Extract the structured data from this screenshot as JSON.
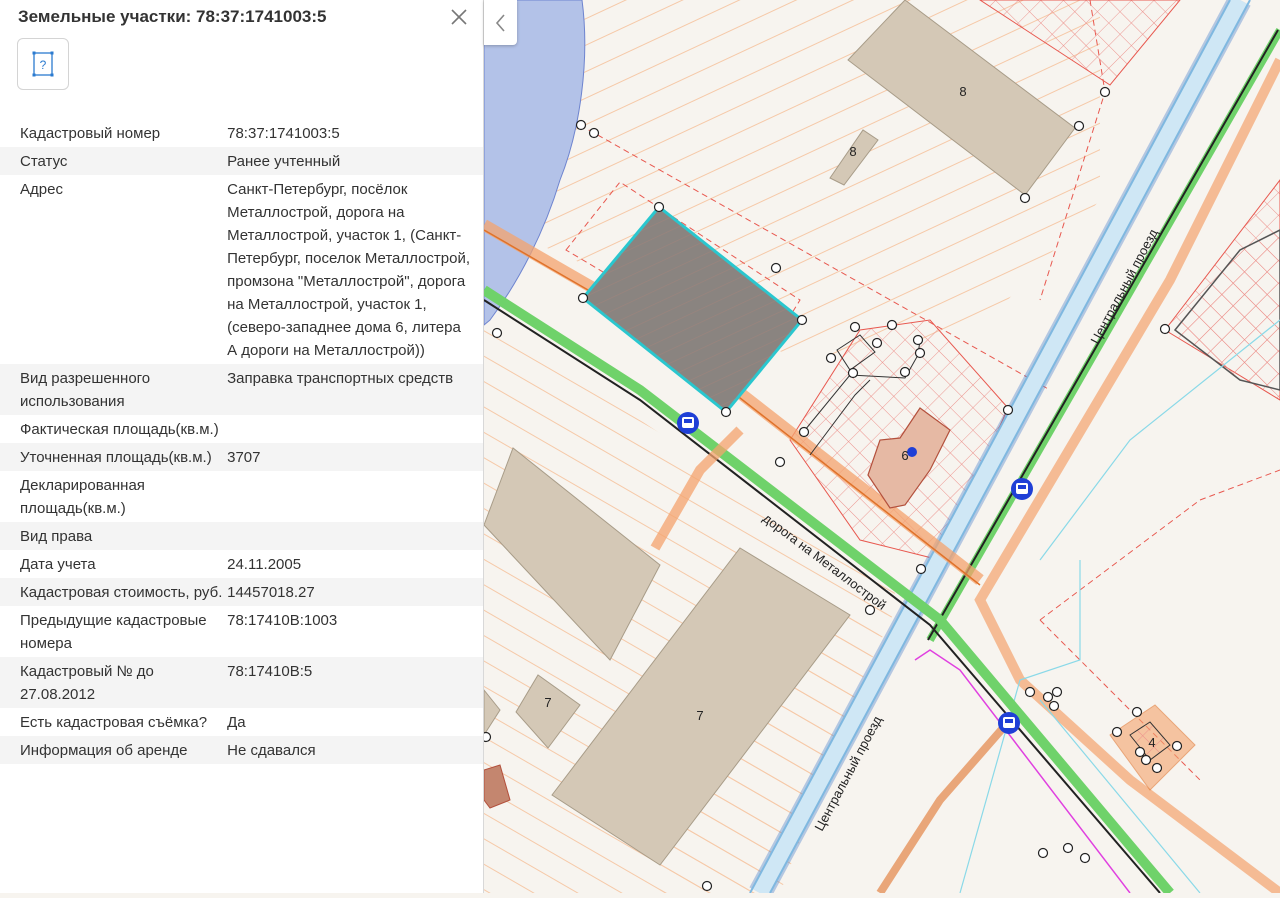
{
  "panel": {
    "title": "Земельные участки: 78:37:1741003:5",
    "close_icon": "close-icon",
    "help_icon": "parcel-help-icon",
    "rows": [
      {
        "key": "Кадастровый номер",
        "value": "78:37:1741003:5"
      },
      {
        "key": "Статус",
        "value": "Ранее учтенный"
      },
      {
        "key": "Адрес",
        "value": "Санкт-Петербург, посёлок Металлострой, дорога на Металлострой, участок 1, (Санкт-Петербург, поселок Металлострой, промзона \"Металлострой\", дорога на Металлострой, участок 1, (северо-западнее дома 6, литера А дороги на Металлострой))"
      },
      {
        "key": "Вид разрешенного использования",
        "value": "Заправка транспортных средств"
      },
      {
        "key": "Фактическая площадь(кв.м.)",
        "value": ""
      },
      {
        "key": "Уточненная площадь(кв.м.)",
        "value": "3707"
      },
      {
        "key": "Декларированная площадь(кв.м.)",
        "value": ""
      },
      {
        "key": "Вид права",
        "value": ""
      },
      {
        "key": "Дата учета",
        "value": "24.11.2005"
      },
      {
        "key": "Кадастровая стоимость, руб.",
        "value": "14457018.27"
      },
      {
        "key": "Предыдущие кадастровые номера",
        "value": "78:17410В:1003"
      },
      {
        "key": "Кадастровый № до 27.08.2012",
        "value": "78:17410В:5"
      },
      {
        "key": "Есть кадастровая съёмка?",
        "value": "Да"
      },
      {
        "key": "Информация об аренде",
        "value": "Не сдавался"
      }
    ]
  },
  "map": {
    "collapse_icon": "chevron-left-icon",
    "building_labels": [
      "8",
      "8",
      "6",
      "7",
      "7",
      "4"
    ],
    "road_labels": [
      "Центральный проезд",
      "дорога на Металлострой",
      "Центральный проезд"
    ],
    "bus_stop_icon": "bus-stop-icon",
    "colors": {
      "background": "#f7f4ef",
      "water": "#b3c2e8",
      "building": "#d4c8b6",
      "selected_parcel_fill": "#8a8480",
      "selected_parcel_border": "#29c7cf",
      "hatch": "#f6c9a8",
      "parcel_border": "#e8584f",
      "road_orange": "#f4a36d",
      "road_green": "#6fd26a",
      "road_blue": "#9fd0ea",
      "bus_stop": "#1f3fd6"
    }
  }
}
